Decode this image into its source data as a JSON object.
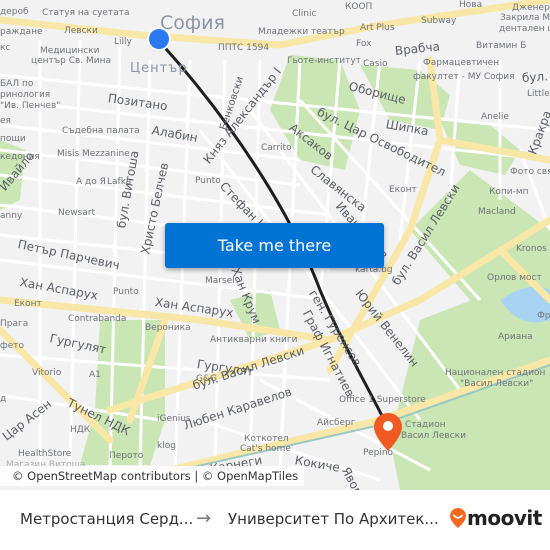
{
  "map": {
    "city_label": "София",
    "district_label": "Център",
    "street_labels": [
      "Позитано",
      "Алабин",
      "Врабча",
      "Оборище",
      "бул. Цар Освободител",
      "Шипка",
      "Аксаков",
      "Княз Александър I",
      "Бенковски",
      "Славянска",
      "Иван Вазов",
      "Стефан Караджа",
      "Христо Белчев",
      "бул. Витоша",
      "Ивайло",
      "Петър Парчевич",
      "Хан Аспарух",
      "Хан Аспарух",
      "Хан Крум",
      "ген. Гуренсов",
      "Граф Игнатиев",
      "Юрий Венелин",
      "бул. Васил Левски",
      "бул. Васил Левски",
      "Гургулят",
      "Гургулят",
      "Тунел НДК",
      "Цар Асен",
      "Любен Каравелов",
      "Кокиче",
      "Яворов",
      "Карнеги",
      "бул.",
      "Кракра"
    ],
    "poi_labels": [
      "Статуя на суетата",
      "Левски",
      "Lilly",
      "Медицински",
      "център Св. Мина",
      "ППТС 1594",
      "Младежки театър",
      "Clinic",
      "КООП",
      "Art Plus",
      "Fox",
      "Гьоте-институт",
      "Casio",
      "Subway",
      "Нова",
      "Дженерал",
      "Закрила Ме",
      "дентален це",
      "Витамин Б",
      "Фармацевтичен",
      "факултет - МУ София",
      "Little",
      "Anelie",
      "Съдебна палата",
      "Misis Mezzanine",
      "А до Я",
      "Lafka",
      "Newsart",
      "Punto",
      "Carrito",
      "Punto",
      "Marsel",
      "Еконт",
      "Фото свят",
      "Копи-мп",
      "Macland",
      "Kronos",
      "Орлов мост",
      "karta.bg",
      "Еконт",
      "Contrabanda",
      "Вероника",
      "Антикварни книги",
      "Прага",
      "Vitorio",
      "A1",
      "G&G",
      "iGenius",
      "НДК",
      "klog",
      "HealthStore",
      "Перото",
      "Коткотел",
      "Cat's home",
      "Айсберг",
      "Office 1 Superstore",
      "Стадион",
      "Васил Левски",
      "Pepino",
      "Ариана",
      "Национален стадион",
      "\"Васил Левски\"",
      "Фре",
      "БАЛ по",
      "ринология",
      "\"Ив. Пенчев\"",
      "дероб",
      "раждане",
      "кс",
      "ея",
      "пощи",
      "кедония",
      "anny",
      "Магазин Витоша",
      "фето",
      "д"
    ],
    "attribution": "© OpenStreetMap contributors | © OpenMapTiles",
    "origin_marker_color": "#2a79f0",
    "destination_marker_color": "#f05a22",
    "route_line_color": "#1e1e1e"
  },
  "cta": {
    "label": "Take me there",
    "color": "#0073d4"
  },
  "footer": {
    "from": "Метростанция Серд...",
    "arrow": "→",
    "to": "Университет По Архитек...",
    "logo_text": "moovit",
    "logo_color": "#f26a21"
  }
}
